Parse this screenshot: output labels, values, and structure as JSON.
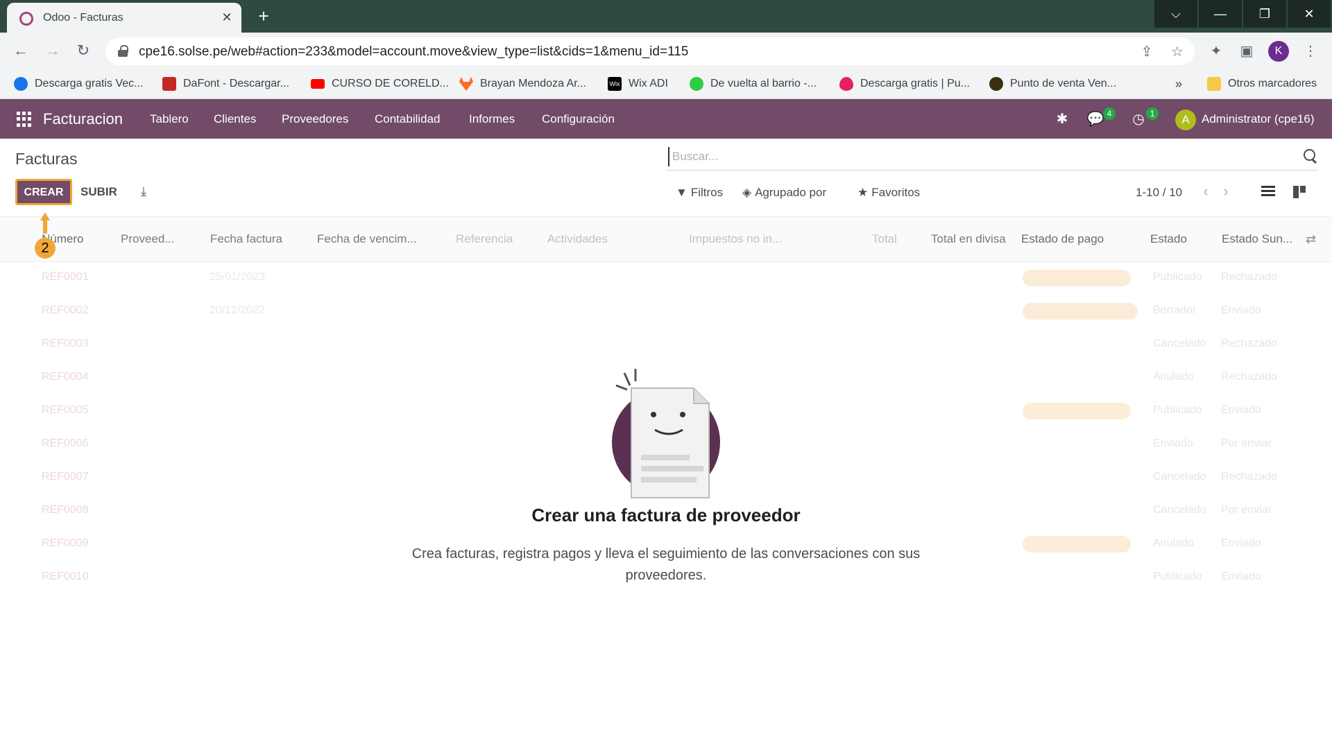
{
  "browser": {
    "tab_title": "Odoo - Facturas",
    "url": "cpe16.solse.pe/web#action=233&model=account.move&view_type=list&cids=1&menu_id=115",
    "profile_initial": "K",
    "bookmarks": [
      {
        "label": "Descarga gratis Vec...",
        "icon": "freepik-icon",
        "color": "#1a73e8"
      },
      {
        "label": "DaFont - Descargar...",
        "icon": "dafont-icon",
        "color": "#c62828"
      },
      {
        "label": "CURSO DE CORELD...",
        "icon": "youtube-icon",
        "color": "#ff0000"
      },
      {
        "label": "Brayan Mendoza Ar...",
        "icon": "gitlab-icon",
        "color": "#fc6d26"
      },
      {
        "label": "Wix ADI",
        "icon": "wix-icon",
        "color": "#000000"
      },
      {
        "label": "De vuelta al barrio -...",
        "icon": "play-icon",
        "color": "#2ecc40"
      },
      {
        "label": "Descarga gratis | Pu...",
        "icon": "pink-drop-icon",
        "color": "#e91e63"
      },
      {
        "label": "Punto de venta Ven...",
        "icon": "star-badge-icon",
        "color": "#3c2f14"
      }
    ],
    "other_bookmarks": "Otros marcadores"
  },
  "odoo_nav": {
    "brand": "Facturacion",
    "menu": [
      "Tablero",
      "Clientes",
      "Proveedores",
      "Contabilidad",
      "Informes",
      "Configuración"
    ],
    "messages_badge": "4",
    "activities_badge": "1",
    "user_initial": "A",
    "user_name": "Administrator (cpe16)"
  },
  "control_panel": {
    "breadcrumb": "Facturas",
    "search_placeholder": "Buscar...",
    "create_label": "CREAR",
    "upload_label": "SUBIR",
    "filters_label": "Filtros",
    "group_by_label": "Agrupado por",
    "favorites_label": "Favoritos",
    "pager": "1-10 / 10"
  },
  "table": {
    "columns": [
      "Número",
      "Proveed...",
      "Fecha factura",
      "Fecha de vencim...",
      "Referencia",
      "Actividades",
      "Impuestos no in...",
      "Total",
      "Total en divisa",
      "Estado de pago",
      "Estado",
      "Estado Sun..."
    ],
    "rows": [
      {
        "num": "REF0001",
        "date": "25/01/2023",
        "state_text": "Publicado",
        "sunat": "Rechazado"
      },
      {
        "num": "REF0002",
        "date": "20/12/2022",
        "state_text": "Borrador",
        "sunat": "Enviado"
      },
      {
        "num": "REF0003",
        "date": "",
        "state_text": "Cancelado",
        "sunat": "Rechazado"
      },
      {
        "num": "REF0004",
        "date": "",
        "state_text": "Anulado",
        "sunat": "Rechazado"
      },
      {
        "num": "REF0005",
        "date": "",
        "state_text": "Publicado",
        "sunat": "Enviado"
      },
      {
        "num": "REF0006",
        "date": "",
        "state_text": "Enviado",
        "sunat": "Por enviar"
      },
      {
        "num": "REF0007",
        "date": "",
        "state_text": "Cancelado",
        "sunat": "Rechazado"
      },
      {
        "num": "REF0008",
        "date": "",
        "state_text": "Cancelado",
        "sunat": "Por enviar"
      },
      {
        "num": "REF0009",
        "date": "",
        "state_text": "Anulado",
        "sunat": "Enviado"
      },
      {
        "num": "REF0010",
        "date": "",
        "state_text": "Publicado",
        "sunat": "Enviado"
      }
    ]
  },
  "annotation": {
    "step": "2"
  },
  "empty_state": {
    "title": "Crear una factura de proveedor",
    "text": "Crea facturas, registra pagos y lleva el seguimiento de las conversaciones con sus proveedores."
  },
  "colors": {
    "odoo_purple": "#714b67",
    "highlight_orange": "#f0a637",
    "badge_green": "#28a745"
  }
}
